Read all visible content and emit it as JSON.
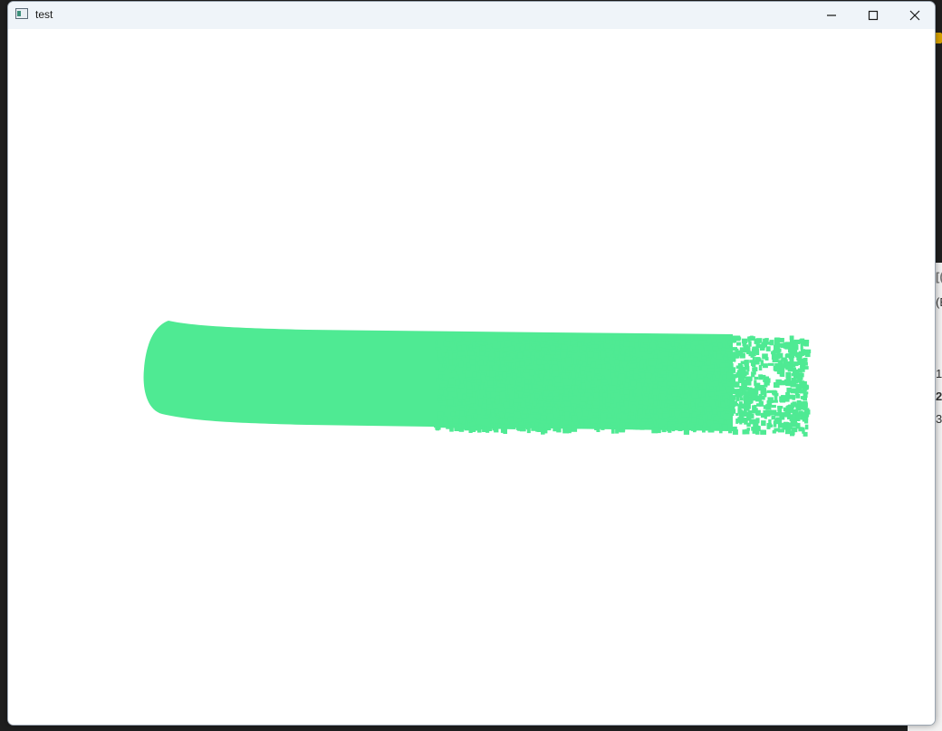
{
  "window": {
    "title": "test",
    "app_icon": "window-app-icon",
    "buttons": {
      "minimize_icon": "minimize-icon",
      "maximize_icon": "maximize-icon",
      "close_icon": "close-icon"
    }
  },
  "viewport": {
    "background_color": "#ffffff",
    "point_cloud_color": "#4fea93",
    "object": "cylinder-point-cloud"
  },
  "background_app": {
    "accent_color": "#d8a300",
    "partial_texts": [
      "[(",
      "(E",
      "1",
      "2",
      "3"
    ]
  }
}
